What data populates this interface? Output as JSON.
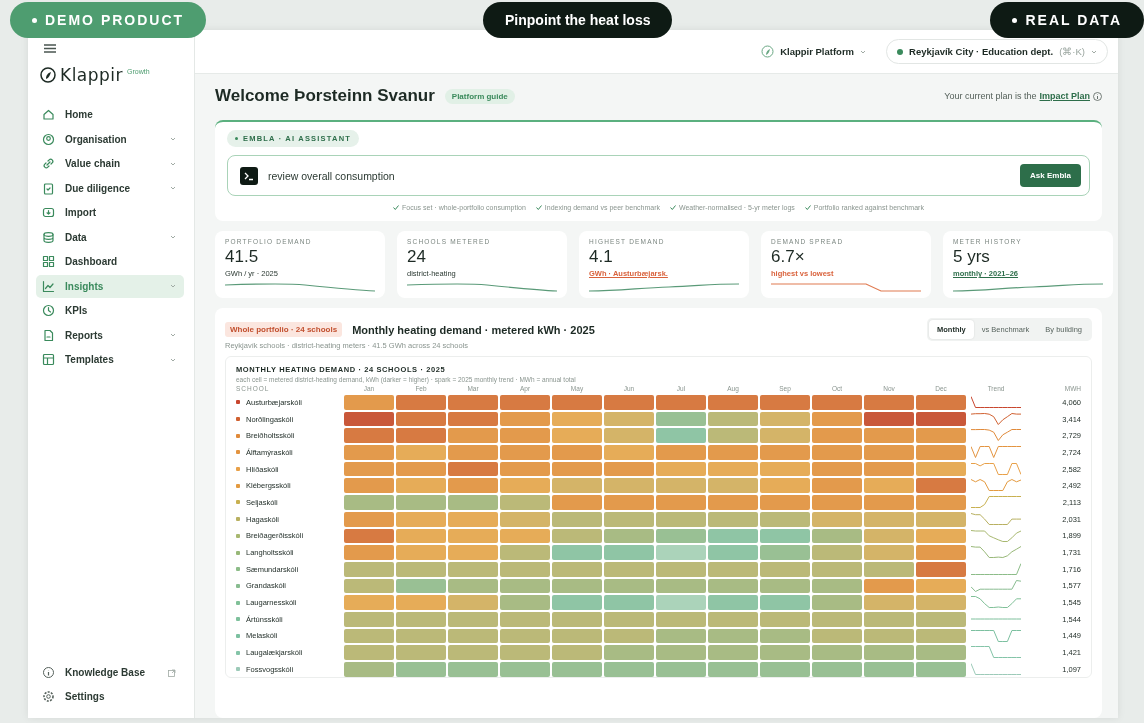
{
  "banners": [
    {
      "text": "DEMO PRODUCT",
      "kind": "demo"
    },
    {
      "text": "Pinpoint the heat loss",
      "kind": "headline"
    },
    {
      "text": "REAL DATA",
      "kind": "real"
    }
  ],
  "sidebar": {
    "logo": {
      "name": "Klappir",
      "tier": "Growth"
    },
    "items": [
      {
        "label": "Home",
        "selected": false,
        "expandable": false
      },
      {
        "label": "Organisation",
        "selected": false,
        "expandable": true
      },
      {
        "label": "Value chain",
        "selected": false,
        "expandable": true
      },
      {
        "label": "Due diligence",
        "selected": false,
        "expandable": true
      },
      {
        "label": "Import",
        "selected": false,
        "expandable": false
      },
      {
        "label": "Data",
        "selected": false,
        "expandable": true
      },
      {
        "label": "Dashboard",
        "selected": false,
        "expandable": false
      },
      {
        "label": "Insights",
        "selected": true,
        "expandable": true
      },
      {
        "label": "KPIs",
        "selected": false,
        "expandable": false
      },
      {
        "label": "Reports",
        "selected": false,
        "expandable": true
      },
      {
        "label": "Templates",
        "selected": false,
        "expandable": true
      }
    ],
    "footer_items": [
      {
        "label": "Knowledge Base",
        "external": true
      },
      {
        "label": "Settings",
        "external": false
      }
    ]
  },
  "topbar": {
    "platform": "Klappir Platform",
    "org": {
      "label": "Reykjavík City · Education dept.",
      "shortcut": "(⌘·K)"
    }
  },
  "welcome": {
    "title": "Welcome Þorsteinn Svanur",
    "guide": "Platform guide",
    "plan_text": "Your current plan is the",
    "plan_link": "Impact Plan"
  },
  "assistant": {
    "tag": "EMBLA · AI ASSISTANT",
    "query": "review overall consumption",
    "button": "Ask Embla",
    "steps": [
      "Focus set · whole-portfolio consumption",
      "Indexing demand vs peer benchmark",
      "Weather-normalised · 5-yr meter logs",
      "Portfolio ranked against benchmark"
    ]
  },
  "kpis": [
    {
      "label": "PORTFOLIO DEMAND",
      "value": "41.5",
      "note": "GWh / yr · 2025",
      "underlined": false
    },
    {
      "label": "SCHOOLS METERED",
      "value": "24",
      "note": "district-heating",
      "underlined": false
    },
    {
      "label": "HIGHEST DEMAND",
      "value": "4.1",
      "note": "GWh · Austurbæjarsk.",
      "color": "#d9623c",
      "underlined": true
    },
    {
      "label": "DEMAND SPREAD",
      "value": "6.7×",
      "note": "highest vs lowest",
      "color": "#d9623c",
      "underlined": false
    },
    {
      "label": "METER HISTORY",
      "value": "5 yrs",
      "note": "monthly · 2021–26",
      "color": "#2d6e4a",
      "underlined": true
    }
  ],
  "heatmap": {
    "tag": "Whole portfolio · 24 schools",
    "title": "Monthly heating demand · metered kWh · 2025",
    "subtitle": "Reykjavík schools · district-heating meters · 41.5 GWh across 24 schools",
    "views": [
      {
        "label": "Monthly",
        "selected": true
      },
      {
        "label": "vs Benchmark",
        "selected": false
      },
      {
        "label": "By building",
        "selected": false
      }
    ],
    "card_title": "MONTHLY HEATING DEMAND · 24 SCHOOLS · 2025",
    "card_note": "each cell = metered district-heating demand, kWh (darker = higher) · spark = 2025 monthly trend · MWh = annual total",
    "columns": [
      "SCHOOL",
      "Jan",
      "Feb",
      "Mar",
      "Apr",
      "May",
      "Jun",
      "Jul",
      "Aug",
      "Sep",
      "Oct",
      "Nov",
      "Dec",
      "Trend",
      "MWH"
    ],
    "rows": [
      {
        "school": "Austurbæjarskóli",
        "color": "#c8462e",
        "total": "4,060",
        "cells": [
          {
            "color": "#e39a4c"
          },
          {
            "color": "#d77a42"
          },
          {
            "color": "#d77a42"
          },
          {
            "color": "#d77a42"
          },
          {
            "color": "#d77a42"
          },
          {
            "color": "#d77a42"
          },
          {
            "color": "#d77a42"
          },
          {
            "color": "#d77a42"
          },
          {
            "color": "#d77a42"
          },
          {
            "color": "#d77a42"
          },
          {
            "color": "#d77a42"
          },
          {
            "color": "#d77a42"
          }
        ]
      },
      {
        "school": "Norðlingaskóli",
        "color": "#d06030",
        "total": "3,414",
        "cells": [
          {
            "color": "#c9583a"
          },
          {
            "color": "#d77a42"
          },
          {
            "color": "#d77a42"
          },
          {
            "color": "#e39a4c"
          },
          {
            "color": "#e6ac58"
          },
          {
            "color": "#d4b468"
          },
          {
            "color": "#99c094"
          },
          {
            "color": "#bbb978"
          },
          {
            "color": "#d4b468"
          },
          {
            "color": "#e39a4c"
          },
          {
            "color": "#c9583a"
          },
          {
            "color": "#c9583a"
          }
        ]
      },
      {
        "school": "Breiðholtsskóli",
        "color": "#e08a3a",
        "total": "2,729",
        "cells": [
          {
            "color": "#d77a42"
          },
          {
            "color": "#d77a42"
          },
          {
            "color": "#e39a4c"
          },
          {
            "color": "#e39a4c"
          },
          {
            "color": "#e6ac58"
          },
          {
            "color": "#d4b468"
          },
          {
            "color": "#8fc5a5"
          },
          {
            "color": "#bbb978"
          },
          {
            "color": "#d4b468"
          },
          {
            "color": "#e39a4c"
          },
          {
            "color": "#e39a4c"
          },
          {
            "color": "#e39a4c"
          }
        ]
      },
      {
        "school": "Álftamýraskóli",
        "color": "#e39440",
        "total": "2,724",
        "cells": [
          {
            "color": "#e39a4c"
          },
          {
            "color": "#e6ac58"
          },
          {
            "color": "#e39a4c"
          },
          {
            "color": "#e39a4c"
          },
          {
            "color": "#e39a4c"
          },
          {
            "color": "#e6ac58"
          },
          {
            "color": "#e39a4c"
          },
          {
            "color": "#e39a4c"
          },
          {
            "color": "#e39a4c"
          },
          {
            "color": "#e39a4c"
          },
          {
            "color": "#e39a4c"
          },
          {
            "color": "#e39a4c"
          }
        ]
      },
      {
        "school": "Hlíðaskóli",
        "color": "#e8a048",
        "total": "2,582",
        "cells": [
          {
            "color": "#e39a4c"
          },
          {
            "color": "#e39a4c"
          },
          {
            "color": "#d77a42"
          },
          {
            "color": "#e39a4c"
          },
          {
            "color": "#e39a4c"
          },
          {
            "color": "#e39a4c"
          },
          {
            "color": "#e6ac58"
          },
          {
            "color": "#e6ac58"
          },
          {
            "color": "#e6ac58"
          },
          {
            "color": "#e39a4c"
          },
          {
            "color": "#e39a4c"
          },
          {
            "color": "#e6ac58"
          }
        ]
      },
      {
        "school": "Klébergsskóli",
        "color": "#e39a40",
        "total": "2,492",
        "cells": [
          {
            "color": "#e39a4c"
          },
          {
            "color": "#e6ac58"
          },
          {
            "color": "#e39a4c"
          },
          {
            "color": "#e6ac58"
          },
          {
            "color": "#d4b468"
          },
          {
            "color": "#d4b468"
          },
          {
            "color": "#d4b468"
          },
          {
            "color": "#d4b468"
          },
          {
            "color": "#e6ac58"
          },
          {
            "color": "#e39a4c"
          },
          {
            "color": "#e6ac58"
          },
          {
            "color": "#d77a42"
          }
        ]
      },
      {
        "school": "Seljaskóli",
        "color": "#c8b050",
        "total": "2,113",
        "cells": [
          {
            "color": "#a8bb84"
          },
          {
            "color": "#a8bb84"
          },
          {
            "color": "#a8bb84"
          },
          {
            "color": "#bbb978"
          },
          {
            "color": "#e39a4c"
          },
          {
            "color": "#e39a4c"
          },
          {
            "color": "#e39a4c"
          },
          {
            "color": "#e39a4c"
          },
          {
            "color": "#e39a4c"
          },
          {
            "color": "#e39a4c"
          },
          {
            "color": "#e39a4c"
          },
          {
            "color": "#e39a4c"
          }
        ]
      },
      {
        "school": "Hagaskóli",
        "color": "#b8b060",
        "total": "2,031",
        "cells": [
          {
            "color": "#e39a4c"
          },
          {
            "color": "#e6ac58"
          },
          {
            "color": "#e6ac58"
          },
          {
            "color": "#d4b468"
          },
          {
            "color": "#bbb978"
          },
          {
            "color": "#bbb978"
          },
          {
            "color": "#bbb978"
          },
          {
            "color": "#bbb978"
          },
          {
            "color": "#bbb978"
          },
          {
            "color": "#d4b468"
          },
          {
            "color": "#d4b468"
          },
          {
            "color": "#d4b468"
          }
        ]
      },
      {
        "school": "Breiðagerðisskóli",
        "color": "#a8b870",
        "total": "1,899",
        "cells": [
          {
            "color": "#d77a42"
          },
          {
            "color": "#e6ac58"
          },
          {
            "color": "#e6ac58"
          },
          {
            "color": "#e6ac58"
          },
          {
            "color": "#bbb978"
          },
          {
            "color": "#a8bb84"
          },
          {
            "color": "#99c094"
          },
          {
            "color": "#8fc5a5"
          },
          {
            "color": "#8fc5a5"
          },
          {
            "color": "#a8bb84"
          },
          {
            "color": "#d4b468"
          },
          {
            "color": "#e6ac58"
          }
        ]
      },
      {
        "school": "Langholtsskóli",
        "color": "#98b878",
        "total": "1,731",
        "cells": [
          {
            "color": "#e39a4c"
          },
          {
            "color": "#e6ac58"
          },
          {
            "color": "#e6ac58"
          },
          {
            "color": "#bbb978"
          },
          {
            "color": "#8fc5a5"
          },
          {
            "color": "#8fc5a5"
          },
          {
            "color": "#abd3ba"
          },
          {
            "color": "#8fc5a5"
          },
          {
            "color": "#99c094"
          },
          {
            "color": "#bbb978"
          },
          {
            "color": "#d4b468"
          },
          {
            "color": "#e39a4c"
          }
        ]
      },
      {
        "school": "Sæmundarskóli",
        "color": "#8cbc88",
        "total": "1,716",
        "cells": [
          {
            "color": "#bbb978"
          },
          {
            "color": "#bbb978"
          },
          {
            "color": "#bbb978"
          },
          {
            "color": "#bbb978"
          },
          {
            "color": "#bbb978"
          },
          {
            "color": "#bbb978"
          },
          {
            "color": "#bbb978"
          },
          {
            "color": "#bbb978"
          },
          {
            "color": "#bbb978"
          },
          {
            "color": "#bbb978"
          },
          {
            "color": "#bbb978"
          },
          {
            "color": "#d77a42"
          }
        ]
      },
      {
        "school": "Grandaskóli",
        "color": "#88bc90",
        "total": "1,577",
        "cells": [
          {
            "color": "#bbb978"
          },
          {
            "color": "#99c094"
          },
          {
            "color": "#a8bb84"
          },
          {
            "color": "#a8bb84"
          },
          {
            "color": "#a8bb84"
          },
          {
            "color": "#a8bb84"
          },
          {
            "color": "#a8bb84"
          },
          {
            "color": "#a8bb84"
          },
          {
            "color": "#a8bb84"
          },
          {
            "color": "#a8bb84"
          },
          {
            "color": "#e39a4c"
          },
          {
            "color": "#e6ac58"
          }
        ]
      },
      {
        "school": "Laugarnesskóli",
        "color": "#80c098",
        "total": "1,545",
        "cells": [
          {
            "color": "#e6ac58"
          },
          {
            "color": "#e6ac58"
          },
          {
            "color": "#d4b468"
          },
          {
            "color": "#a8bb84"
          },
          {
            "color": "#8fc5a5"
          },
          {
            "color": "#8fc5a5"
          },
          {
            "color": "#abd3ba"
          },
          {
            "color": "#8fc5a5"
          },
          {
            "color": "#8fc5a5"
          },
          {
            "color": "#a8bb84"
          },
          {
            "color": "#d4b468"
          },
          {
            "color": "#d4b468"
          }
        ]
      },
      {
        "school": "Ártúnsskóli",
        "color": "#7ec09c",
        "total": "1,544",
        "cells": [
          {
            "color": "#bbb978"
          },
          {
            "color": "#bbb978"
          },
          {
            "color": "#bbb978"
          },
          {
            "color": "#bbb978"
          },
          {
            "color": "#bbb978"
          },
          {
            "color": "#bbb978"
          },
          {
            "color": "#bbb978"
          },
          {
            "color": "#bbb978"
          },
          {
            "color": "#bbb978"
          },
          {
            "color": "#bbb978"
          },
          {
            "color": "#bbb978"
          },
          {
            "color": "#bbb978"
          }
        ]
      },
      {
        "school": "Melaskóli",
        "color": "#7cc0a0",
        "total": "1,449",
        "cells": [
          {
            "color": "#bbb978"
          },
          {
            "color": "#bbb978"
          },
          {
            "color": "#bbb978"
          },
          {
            "color": "#bbb978"
          },
          {
            "color": "#bbb978"
          },
          {
            "color": "#bbb978"
          },
          {
            "color": "#a8bb84"
          },
          {
            "color": "#a8bb84"
          },
          {
            "color": "#a8bb84"
          },
          {
            "color": "#bbb978"
          },
          {
            "color": "#bbb978"
          },
          {
            "color": "#bbb978"
          }
        ]
      },
      {
        "school": "Laugalækjarskóli",
        "color": "#84c4a8",
        "total": "1,421",
        "cells": [
          {
            "color": "#bbb978"
          },
          {
            "color": "#bbb978"
          },
          {
            "color": "#bbb978"
          },
          {
            "color": "#bbb978"
          },
          {
            "color": "#bbb978"
          },
          {
            "color": "#a8bb84"
          },
          {
            "color": "#a8bb84"
          },
          {
            "color": "#a8bb84"
          },
          {
            "color": "#a8bb84"
          },
          {
            "color": "#a8bb84"
          },
          {
            "color": "#a8bb84"
          },
          {
            "color": "#a8bb84"
          }
        ]
      },
      {
        "school": "Fossvogsskóli",
        "color": "#9ccab8",
        "total": "1,097",
        "cells": [
          {
            "color": "#a8bb84"
          },
          {
            "color": "#99c094"
          },
          {
            "color": "#99c094"
          },
          {
            "color": "#99c094"
          },
          {
            "color": "#99c094"
          },
          {
            "color": "#99c094"
          },
          {
            "color": "#99c094"
          },
          {
            "color": "#99c094"
          },
          {
            "color": "#99c094"
          },
          {
            "color": "#99c094"
          },
          {
            "color": "#99c094"
          },
          {
            "color": "#99c094"
          }
        ]
      }
    ]
  }
}
